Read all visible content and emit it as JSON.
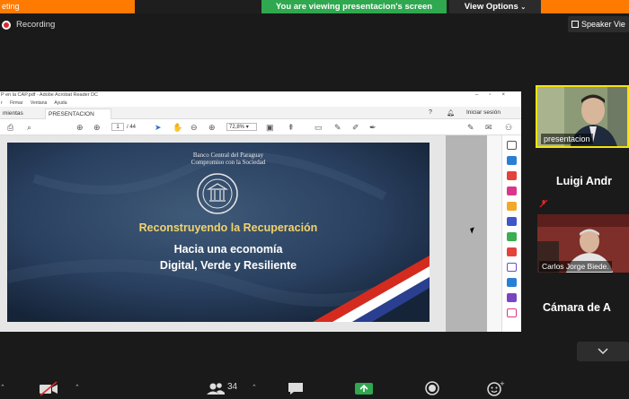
{
  "zoom": {
    "meeting_label": "eting",
    "viewing_banner": "You are viewing presentacion's screen",
    "view_options": "View Options",
    "recording": "Recording",
    "speaker_view": "Speaker Vie"
  },
  "acrobat": {
    "window_title": "P en la CAP.pdf - Adobe Acrobat Reader DC",
    "menu": [
      "r",
      "Firmar",
      "Ventana",
      "Ayuda"
    ],
    "tabs": [
      "mientas",
      "PRESENTACION BC..."
    ],
    "tab_close": "×",
    "help": "?",
    "signin": "Iniciar sesión",
    "page_current": "1",
    "page_total": "/ 44",
    "zoom_level": "72,8%"
  },
  "slide": {
    "bank_name": "Banco Central del Paraguay",
    "bank_tagline": "Compromiso con la Sociedad",
    "title": "Reconstruyendo la Recuperación",
    "subtitle_line1": "Hacia una economía",
    "subtitle_line2": "Digital, Verde y Resiliente"
  },
  "gallery": {
    "presenter_label": "presentacion",
    "participant_1": "Luigi Andr",
    "participant_2_label": "Carlos Jorge Biede.",
    "participant_3": "Cámara de A"
  },
  "toolbar": {
    "participants_count": "34"
  },
  "colors": {
    "banner_green": "#2fa84f",
    "meeting_orange": "#ff7a00",
    "active_speaker": "#f5e30c",
    "slide_title_gold": "#f2d36b"
  }
}
